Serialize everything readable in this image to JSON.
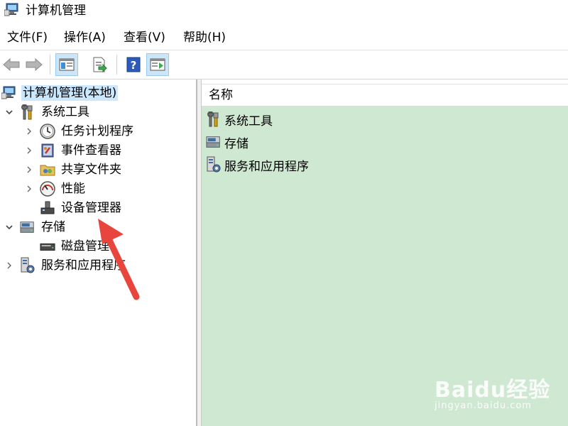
{
  "window": {
    "title": "计算机管理"
  },
  "menu": [
    {
      "label": "文件(F)"
    },
    {
      "label": "操作(A)"
    },
    {
      "label": "查看(V)"
    },
    {
      "label": "帮助(H)"
    }
  ],
  "toolbar": {
    "buttons": [
      {
        "icon": "back-arrow-icon"
      },
      {
        "icon": "forward-arrow-icon"
      },
      {
        "icon": "show-hide-console-tree-icon"
      },
      {
        "icon": "export-list-icon"
      },
      {
        "icon": "help-icon"
      },
      {
        "icon": "show-hide-action-pane-icon"
      }
    ]
  },
  "tree": {
    "root": {
      "label": "计算机管理(本地)",
      "icon": "computer-management-icon"
    },
    "items": [
      {
        "label": "系统工具",
        "icon": "system-tools-icon",
        "expander": "expanded"
      },
      {
        "label": "任务计划程序",
        "icon": "clock-icon",
        "expander": "collapsed"
      },
      {
        "label": "事件查看器",
        "icon": "event-viewer-icon",
        "expander": "collapsed"
      },
      {
        "label": "共享文件夹",
        "icon": "shared-folder-icon",
        "expander": "collapsed"
      },
      {
        "label": "性能",
        "icon": "performance-icon",
        "expander": "collapsed"
      },
      {
        "label": "设备管理器",
        "icon": "device-manager-icon",
        "expander": "none"
      },
      {
        "label": "存储",
        "icon": "storage-icon",
        "expander": "expanded"
      },
      {
        "label": "磁盘管理",
        "icon": "disk-icon",
        "expander": "none"
      },
      {
        "label": "服务和应用程序",
        "icon": "services-icon",
        "expander": "collapsed"
      }
    ]
  },
  "content": {
    "column_header": "名称",
    "rows": [
      {
        "label": "系统工具",
        "icon": "system-tools-icon"
      },
      {
        "label": "存储",
        "icon": "storage-icon"
      },
      {
        "label": "服务和应用程序",
        "icon": "services-icon"
      }
    ]
  },
  "watermark": {
    "main": "Baidu经验",
    "sub": "jingyan.baidu.com"
  },
  "colors": {
    "content_bg": "#cfe8d2",
    "selection": "#cce8ff",
    "arrow": "#e8453c"
  }
}
